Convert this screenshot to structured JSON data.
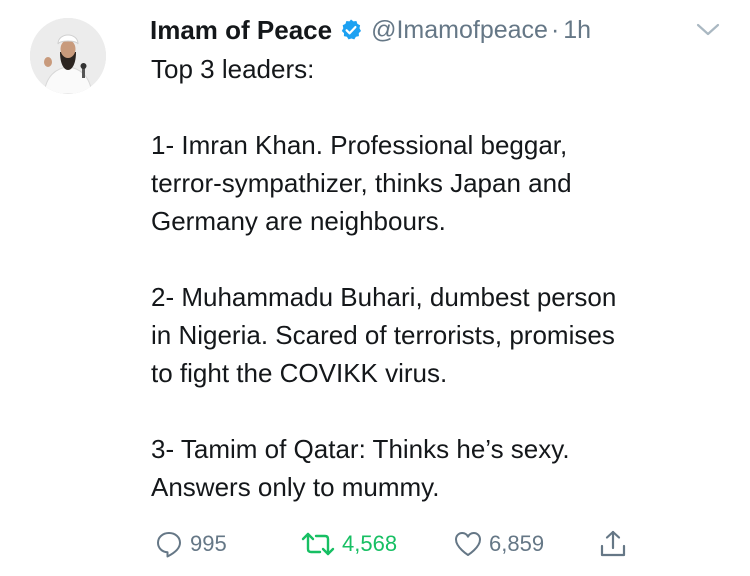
{
  "tweet": {
    "display_name": "Imam of Peace",
    "handle": "@Imamofpeace",
    "separator": "·",
    "time": "1h",
    "lines": [
      "Top 3 leaders:",
      "",
      "1- Imran Khan. Professional beggar,",
      "terror-sympathizer, thinks Japan and",
      "Germany are neighbours.",
      "",
      "2- Muhammadu Buhari, dumbest person",
      "in Nigeria. Scared of terrorists, promises",
      "to fight the COVIKK virus.",
      "",
      "3- Tamim of Qatar: Thinks he’s sexy.",
      "Answers only to mummy."
    ],
    "replies": "995",
    "retweets": "4,568",
    "likes": "6,859"
  },
  "icons": {
    "verified": "verified-badge-icon",
    "caret": "chevron-down-icon",
    "reply": "reply-icon",
    "retweet": "retweet-icon",
    "like": "heart-icon",
    "share": "share-icon"
  },
  "colors": {
    "text": "#14171a",
    "secondary": "#657786",
    "verified": "#1da1f2",
    "retweeted": "#17bf63"
  }
}
